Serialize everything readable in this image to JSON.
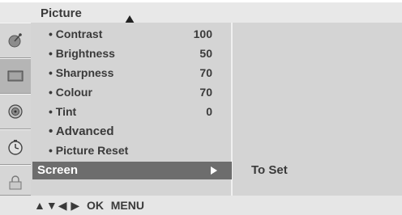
{
  "header": {
    "title": "Picture"
  },
  "sidebar": {
    "icons": [
      "satellite-dish-icon",
      "tv-screen-icon",
      "speaker-icon",
      "clock-icon",
      "lock-icon"
    ]
  },
  "menu": {
    "items": [
      {
        "label": "• Contrast",
        "value": "100"
      },
      {
        "label": "• Brightness",
        "value": "50"
      },
      {
        "label": "• Sharpness",
        "value": "70"
      },
      {
        "label": "• Colour",
        "value": "70"
      },
      {
        "label": "• Tint",
        "value": "0"
      },
      {
        "label": "• Advanced",
        "value": ""
      },
      {
        "label": "• Picture Reset",
        "value": ""
      }
    ],
    "selected": {
      "label": "Screen",
      "hint": "To Set"
    }
  },
  "footer": {
    "arrows": [
      "▲",
      "▼",
      "◀",
      "▶"
    ],
    "ok_label": "OK",
    "menu_label": "MENU"
  }
}
